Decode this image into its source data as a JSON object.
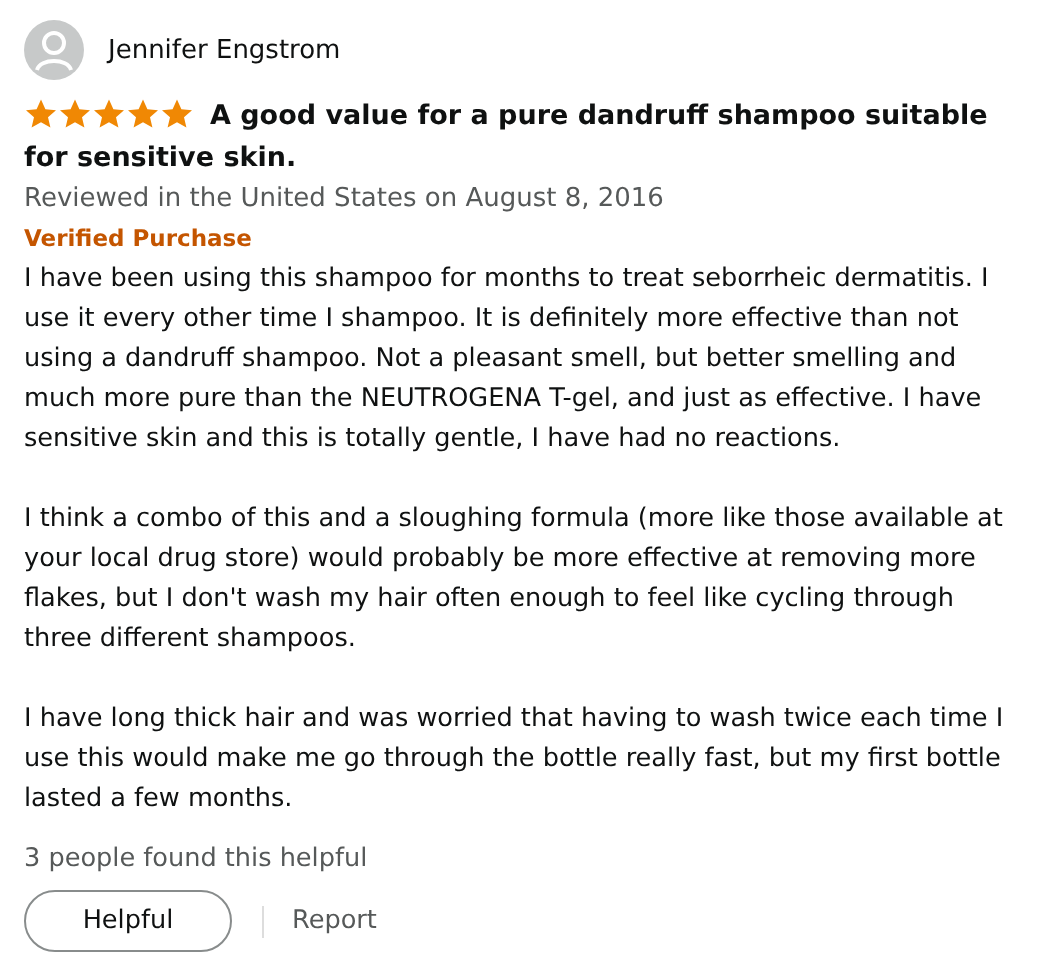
{
  "review": {
    "author": "Jennifer Engstrom",
    "stars": 5,
    "title": "A good value for a pure dandruff shampoo suitable for sensitive skin.",
    "meta": "Reviewed in the United States on August 8, 2016",
    "badge": "Verified Purchase",
    "paragraphs": [
      "I have been using this shampoo for months to treat seborrheic dermatitis. I use it every other time I shampoo. It is definitely more effective than not using a dandruff shampoo. Not a pleasant smell, but better smelling and much more pure than the NEUTROGENA T-gel, and just as effective. I have sensitive skin and this is totally gentle, I have had no reactions.",
      "I think a combo of this and a sloughing formula (more like those available at your local drug store) would probably be more effective at removing more flakes, but I don't wash my hair often enough to feel like cycling through three different shampoos.",
      "I have long thick hair and was worried that having to wash twice each time I use this would make me go through the bottle really fast, but my first bottle lasted a few months."
    ],
    "helpful_count": "3 people found this helpful",
    "helpful_button": "Helpful",
    "report_link": "Report"
  }
}
